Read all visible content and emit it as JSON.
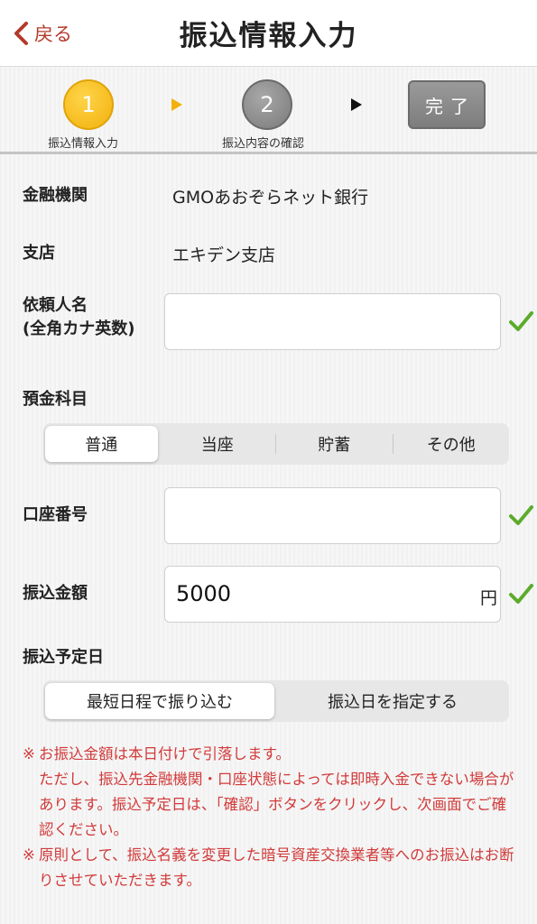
{
  "header": {
    "back_label": "戻る",
    "title": "振込情報入力"
  },
  "steps": {
    "step1_number": "1",
    "step1_label": "振込情報入力",
    "step2_number": "2",
    "step2_label": "振込内容の確認",
    "done_label": "完了"
  },
  "form": {
    "bank_label": "金融機関",
    "bank_value": "GMOあおぞらネット銀行",
    "branch_label": "支店",
    "branch_value": "エキデン支店",
    "requester_label_line1": "依頼人名",
    "requester_label_line2": "(全角カナ英数)",
    "requester_value": "",
    "account_type_label": "預金科目",
    "account_types": [
      "普通",
      "当座",
      "貯蓄",
      "その他"
    ],
    "account_type_selected": "普通",
    "account_number_label": "口座番号",
    "account_number_value": "",
    "amount_label": "振込金額",
    "amount_value": "5000",
    "amount_unit": "円",
    "date_label": "振込予定日",
    "date_options": [
      "最短日程で振り込む",
      "振込日を指定する"
    ],
    "date_selected": "最短日程で振り込む"
  },
  "notes": {
    "note1_mark": "※",
    "note1_text": "お振込金額は本日付けで引落します。",
    "note1_line2": "ただし、振込先金融機関・口座状態によっては即時入金できない場合があります。振込予定日は、「確認」ボタンをクリックし、次画面でご確認ください。",
    "note2_mark": "※",
    "note2_text": "原則として、振込名義を変更した暗号資産交換業者等へのお振込はお断りさせていただきます。"
  },
  "colors": {
    "accent_red": "#b33a2a",
    "note_red": "#d23a3a",
    "step_active": "#f2b10b",
    "step_inactive": "#7a7a7a",
    "check_green": "#5cab2c"
  },
  "icons": {
    "back": "chevron-left-icon",
    "check": "checkmark-icon"
  }
}
